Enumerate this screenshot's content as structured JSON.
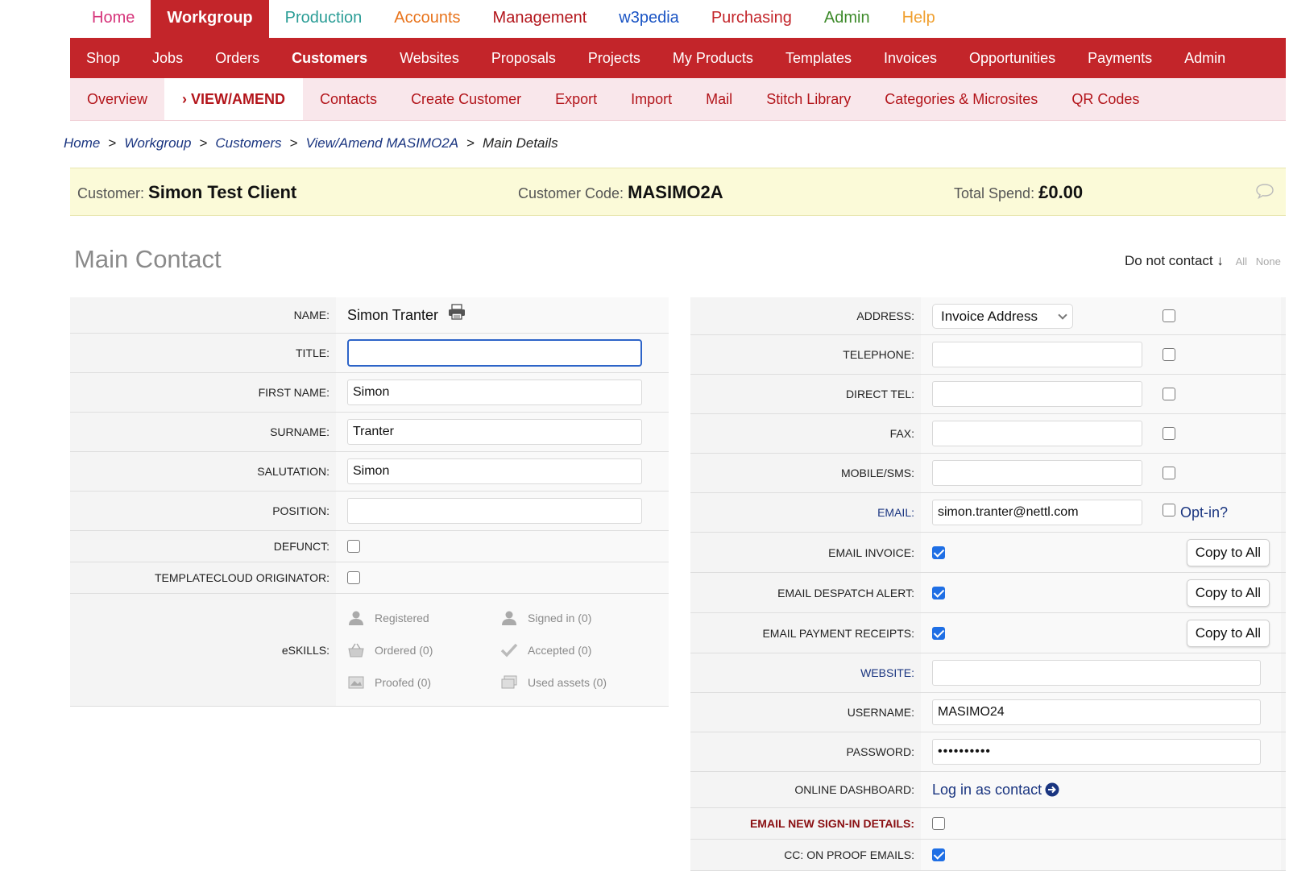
{
  "top_nav": [
    {
      "label": "Home",
      "color": "#d6347a"
    },
    {
      "label": "Workgroup",
      "color": "#ffffff",
      "active": true
    },
    {
      "label": "Production",
      "color": "#2a9d96"
    },
    {
      "label": "Accounts",
      "color": "#e8731b"
    },
    {
      "label": "Management",
      "color": "#b3151b"
    },
    {
      "label": "w3pedia",
      "color": "#1a54c4"
    },
    {
      "label": "Purchasing",
      "color": "#c3252a"
    },
    {
      "label": "Admin",
      "color": "#3d8a2a"
    },
    {
      "label": "Help",
      "color": "#f0a030"
    }
  ],
  "sub_nav": [
    "Shop",
    "Jobs",
    "Orders",
    "Customers",
    "Websites",
    "Proposals",
    "Projects",
    "My Products",
    "Templates",
    "Invoices",
    "Opportunities",
    "Payments",
    "Admin"
  ],
  "sub_nav_active": "Customers",
  "third_nav": [
    "Overview",
    "› VIEW/AMEND",
    "Contacts",
    "Create Customer",
    "Export",
    "Import",
    "Mail",
    "Stitch Library",
    "Categories & Microsites",
    "QR Codes"
  ],
  "breadcrumb": {
    "items": [
      "Home",
      "Workgroup",
      "Customers",
      "View/Amend MASIMO2A"
    ],
    "current": "Main Details",
    "separator": ">"
  },
  "banner": {
    "customer_label": "Customer:",
    "customer_value": "Simon Test Client",
    "code_label": "Customer Code:",
    "code_value": "MASIMO2A",
    "spend_label": "Total Spend:",
    "spend_value": "£0.00"
  },
  "section_title": "Main Contact",
  "do_not_contact": {
    "label": "Do not contact ↓",
    "all": "All",
    "none": "None"
  },
  "left_form": {
    "name_label": "NAME:",
    "name_value": "Simon Tranter",
    "title_label": "TITLE:",
    "title_value": "",
    "first_name_label": "FIRST NAME:",
    "first_name_value": "Simon",
    "surname_label": "SURNAME:",
    "surname_value": "Tranter",
    "salutation_label": "SALUTATION:",
    "salutation_value": "Simon",
    "position_label": "POSITION:",
    "position_value": "",
    "defunct_label": "DEFUNCT:",
    "originator_label": "TEMPLATECLOUD ORIGINATOR:",
    "eskills_label": "eSKILLS:",
    "eskills": {
      "registered": "Registered",
      "signed_in": "Signed in (0)",
      "ordered": "Ordered (0)",
      "accepted": "Accepted (0)",
      "proofed": "Proofed (0)",
      "used_assets": "Used assets (0)"
    }
  },
  "right_form": {
    "address_label": "ADDRESS:",
    "address_value": "Invoice Address",
    "telephone_label": "TELEPHONE:",
    "telephone_value": "",
    "direct_tel_label": "DIRECT TEL:",
    "direct_tel_value": "",
    "fax_label": "FAX:",
    "fax_value": "",
    "mobile_label": "MOBILE/SMS:",
    "mobile_value": "",
    "email_label": "EMAIL:",
    "email_value": "simon.tranter@nettl.com",
    "opt_in_label": "Opt-in?",
    "email_invoice_label": "EMAIL INVOICE:",
    "email_despatch_label": "EMAIL DESPATCH ALERT:",
    "email_payment_label": "EMAIL PAYMENT RECEIPTS:",
    "copy_to_all": "Copy to All",
    "website_label": "WEBSITE:",
    "website_value": "",
    "username_label": "USERNAME:",
    "username_value": "MASIMO24",
    "password_label": "PASSWORD:",
    "password_value": "••••••••••",
    "dashboard_label": "ONLINE DASHBOARD:",
    "dashboard_link": "Log in as contact",
    "email_signin_label": "EMAIL NEW SIGN-IN DETAILS:",
    "cc_proof_label": "CC: ON PROOF EMAILS:"
  }
}
